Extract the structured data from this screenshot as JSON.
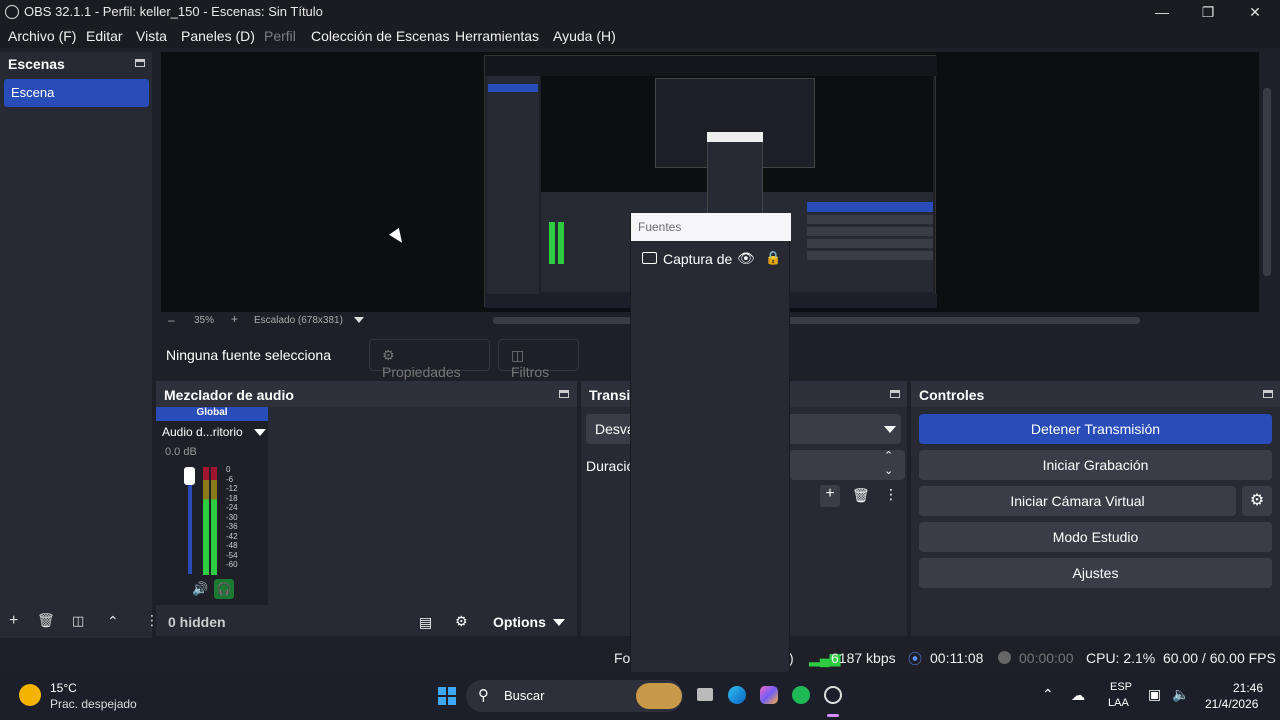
{
  "window": {
    "title": "OBS 32.1.1 - Perfil: keller_150 - Escenas: Sin Título"
  },
  "menu": [
    {
      "label": "Archivo (F)",
      "enabled": true
    },
    {
      "label": "Editar",
      "enabled": true
    },
    {
      "label": "Vista",
      "enabled": true
    },
    {
      "label": "Paneles (D)",
      "enabled": true
    },
    {
      "label": "Perfil",
      "enabled": false
    },
    {
      "label": "Colección de Escenas",
      "enabled": true
    },
    {
      "label": "Herramientas",
      "enabled": true
    },
    {
      "label": "Ayuda (H)",
      "enabled": true
    }
  ],
  "scenes": {
    "title": "Escenas",
    "items": [
      "Escena"
    ]
  },
  "preview": {
    "zoom": "35%",
    "scaling": "Escalado (678x381)"
  },
  "source_bar": {
    "no_source": "Ninguna fuente selecciona",
    "properties": "Propiedades",
    "filters": "Filtros"
  },
  "mixer": {
    "title": "Mezclador de audio",
    "track_header": "Global",
    "source": "Audio d...ritorio",
    "db": "0.0 dB",
    "scale": [
      "0",
      "-6",
      "-12",
      "-18",
      "-24",
      "-30",
      "-36",
      "-42",
      "-48",
      "-54",
      "-60"
    ],
    "hidden": "0 hidden",
    "options": "Options"
  },
  "transitions": {
    "title": "Transi",
    "transition": "Desva",
    "duration_label": "Duració"
  },
  "controls": {
    "title": "Controles",
    "stop_stream": "Detener Transmisión",
    "start_record": "Iniciar Grabación",
    "virtual_cam": "Iniciar Cámara Virtual",
    "studio_mode": "Modo Estudio",
    "settings": "Ajustes"
  },
  "sources_popup": {
    "title": "Fuentes",
    "item": "Captura de"
  },
  "status": {
    "frames_label": "Fo",
    "bracket": ")",
    "bitrate": "6187 kbps",
    "stream_time": "00:11:08",
    "rec_time": "00:00:00",
    "cpu": "CPU: 2.1%",
    "fps": "60.00 / 60.00 FPS"
  },
  "taskbar": {
    "weather_temp": "15°C",
    "weather_desc": "Prac. despejado",
    "search": "Buscar",
    "lang1": "ESP",
    "lang2": "LAA",
    "time": "21:46",
    "date": "21/4/2026"
  },
  "colors": {
    "accent": "#284cb8",
    "meter_green": "#2ecc40",
    "spotify": "#1db954"
  }
}
